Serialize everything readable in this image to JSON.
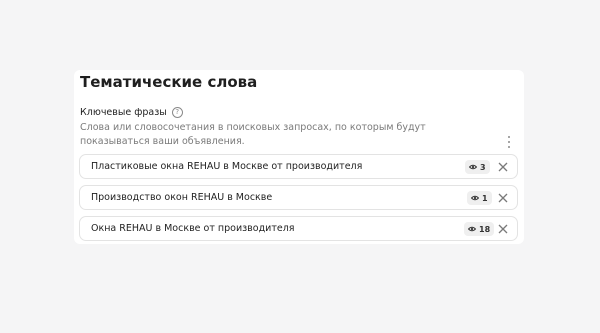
{
  "section": {
    "title": "Тематические слова",
    "keyphrases_label": "Ключевые фразы",
    "help_glyph": "?",
    "description": "Слова или словосочетания в поисковых запросах, по которым будут показываться ваши объявления."
  },
  "phrases": [
    {
      "text": "Пластиковые окна REHAU в Москве от производителя",
      "count": "3"
    },
    {
      "text": "Производство окон REHAU в Москве",
      "count": "1"
    },
    {
      "text": "Окна REHAU в Москве от производителя",
      "count": "18"
    }
  ],
  "icons": {
    "help": "question-circle-icon",
    "more": "kebab-icon",
    "views": "eye-icon",
    "remove": "close-icon"
  },
  "colors": {
    "background": "#f5f5f6",
    "card": "#ffffff",
    "muted_text": "#7a7a7a",
    "badge_bg": "#efefef"
  }
}
